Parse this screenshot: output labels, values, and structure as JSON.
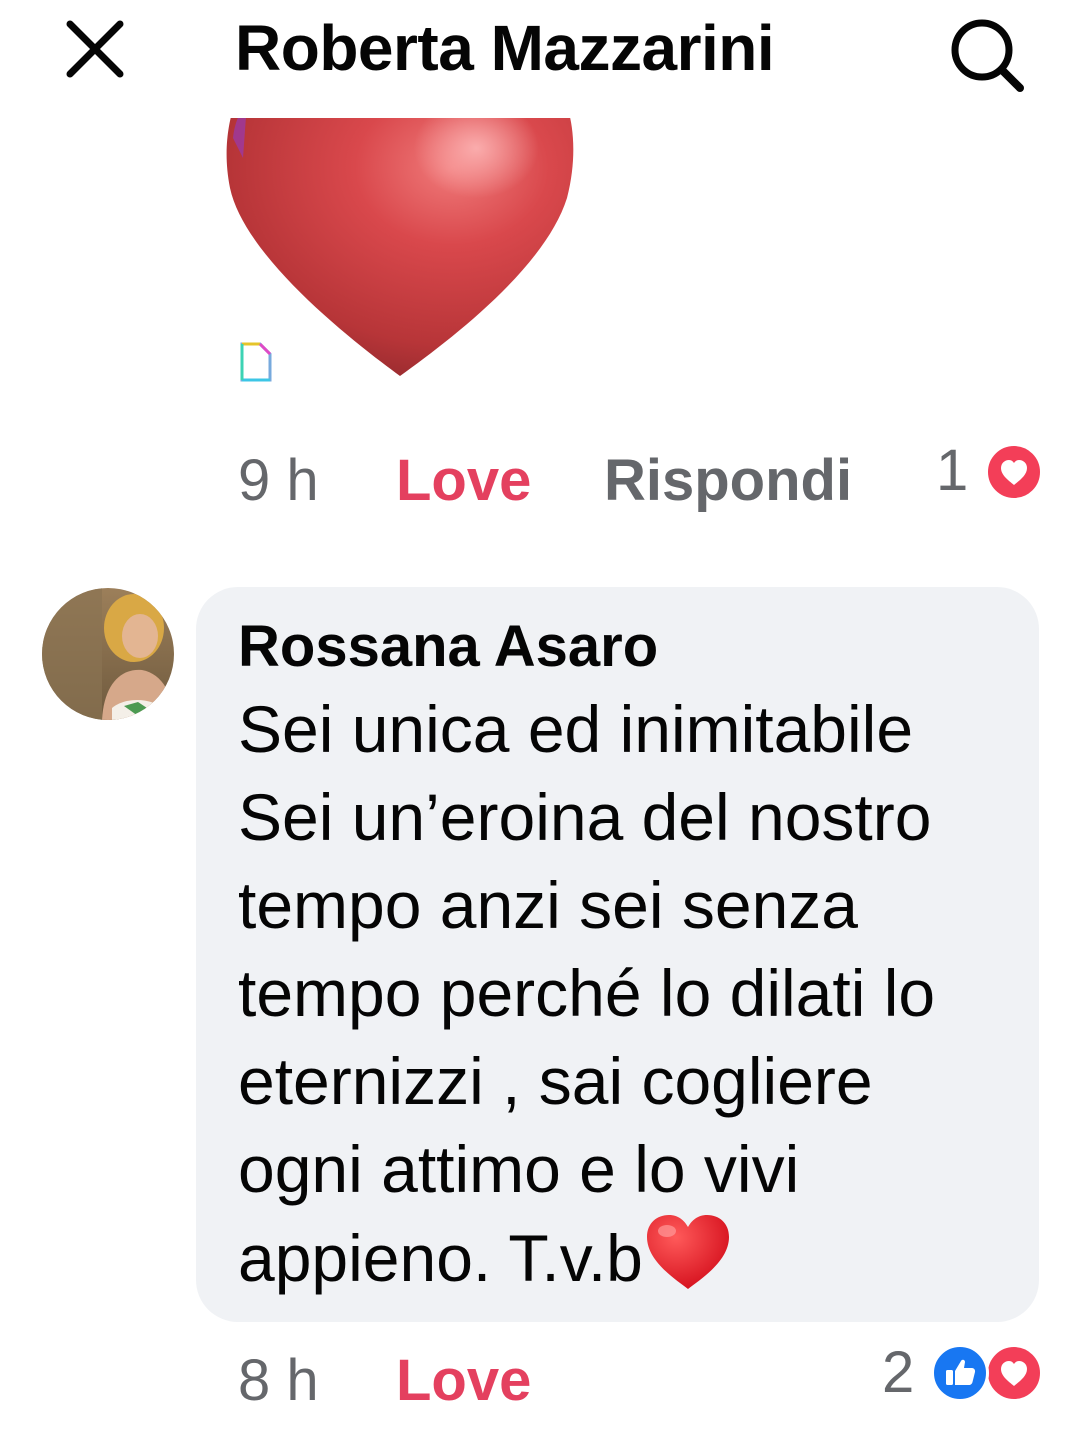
{
  "header": {
    "title": "Roberta Mazzarini"
  },
  "previous_comment": {
    "time": "9 h",
    "love_label": "Love",
    "reply_label": "Rispondi",
    "reaction_count": "1",
    "reaction_icons": [
      "love-icon"
    ]
  },
  "comment": {
    "author": "Rossana Asaro",
    "lines": [
      "Sei unica ed inimitabile",
      "Sei un’eroina del nostro",
      "tempo anzi sei senza",
      "tempo perché lo dilati lo",
      "eternizzi , sai cogliere",
      "ogni attimo e lo vivi",
      "appieno. T.v.b"
    ],
    "emoji": "heart-emoji",
    "time": "8 h",
    "love_label": "Love",
    "reaction_count": "2",
    "reaction_icons": [
      "like-icon",
      "love-icon"
    ]
  },
  "colors": {
    "love": "#e4405f",
    "secondary_text": "#65676b",
    "bubble": "#f0f2f5",
    "like_blue": "#1877f2",
    "love_red": "#f33e58"
  }
}
